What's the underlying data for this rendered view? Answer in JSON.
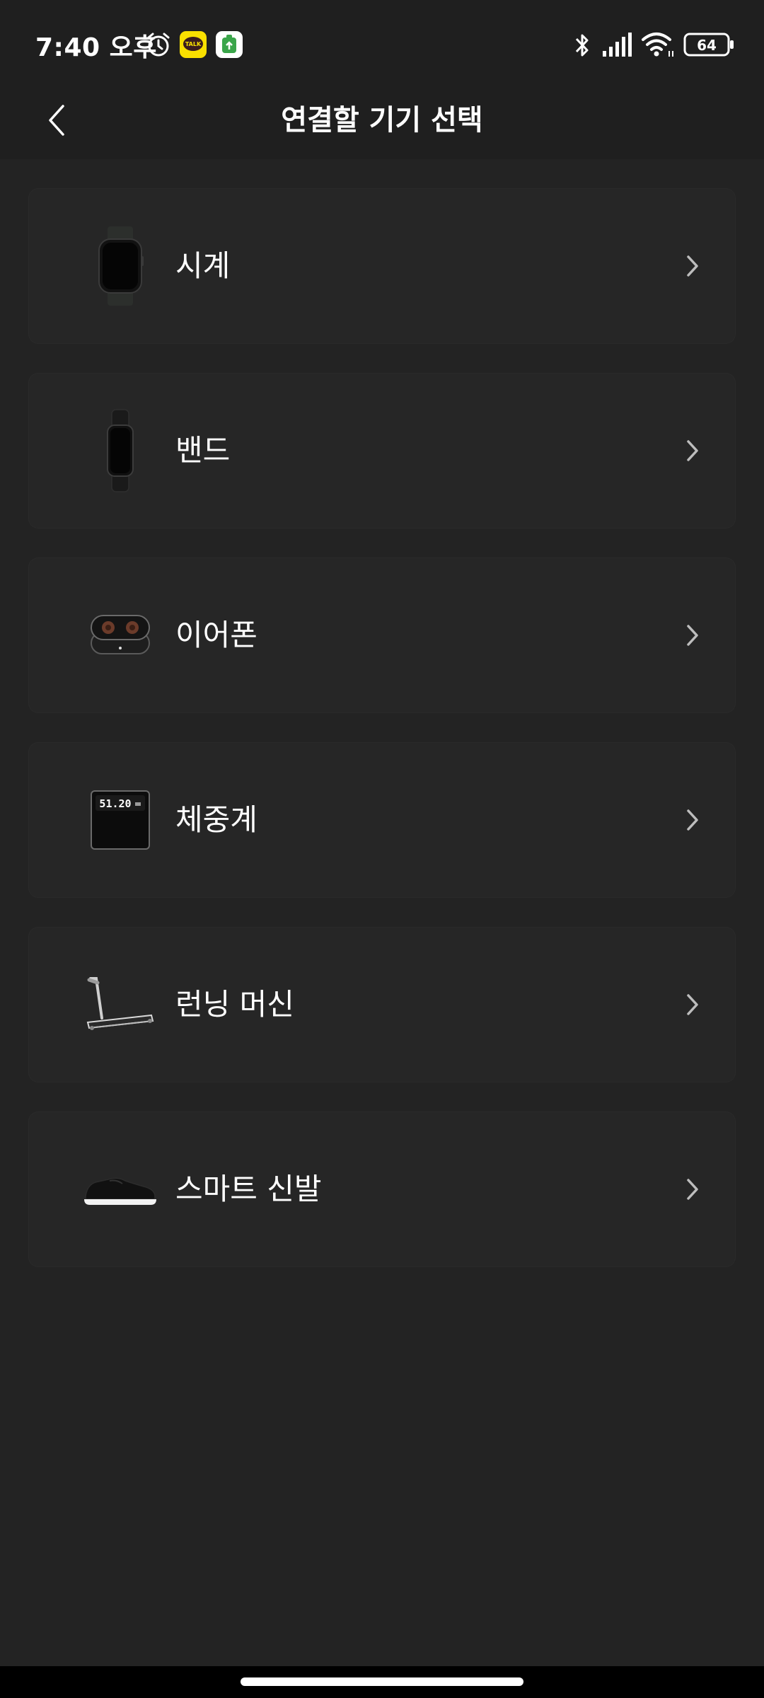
{
  "status_bar": {
    "time": "7:40 오후",
    "battery": "64",
    "kakao_label": "TALK",
    "icons": [
      "alarm-icon",
      "kakaotalk-icon",
      "app-notification-icon",
      "bluetooth-icon",
      "signal-icon",
      "wifi-icon",
      "battery-icon"
    ]
  },
  "header": {
    "title": "연결할 기기 선택",
    "back_icon": "chevron-left-icon"
  },
  "devices": [
    {
      "label": "시계",
      "icon": "watch-icon"
    },
    {
      "label": "밴드",
      "icon": "band-icon"
    },
    {
      "label": "이어폰",
      "icon": "earbuds-icon"
    },
    {
      "label": "체중계",
      "icon": "scale-icon",
      "display_text": "51.20"
    },
    {
      "label": "런닝 머신",
      "icon": "treadmill-icon"
    },
    {
      "label": "스마트 신발",
      "icon": "smart-shoe-icon"
    }
  ],
  "colors": {
    "background": "#232323",
    "card": "#262626",
    "header": "#1f1f1f",
    "text": "#ffffff",
    "chevron": "#bdbdbd",
    "kakao_yellow": "#f9e000",
    "app_green": "#3aa54a"
  }
}
